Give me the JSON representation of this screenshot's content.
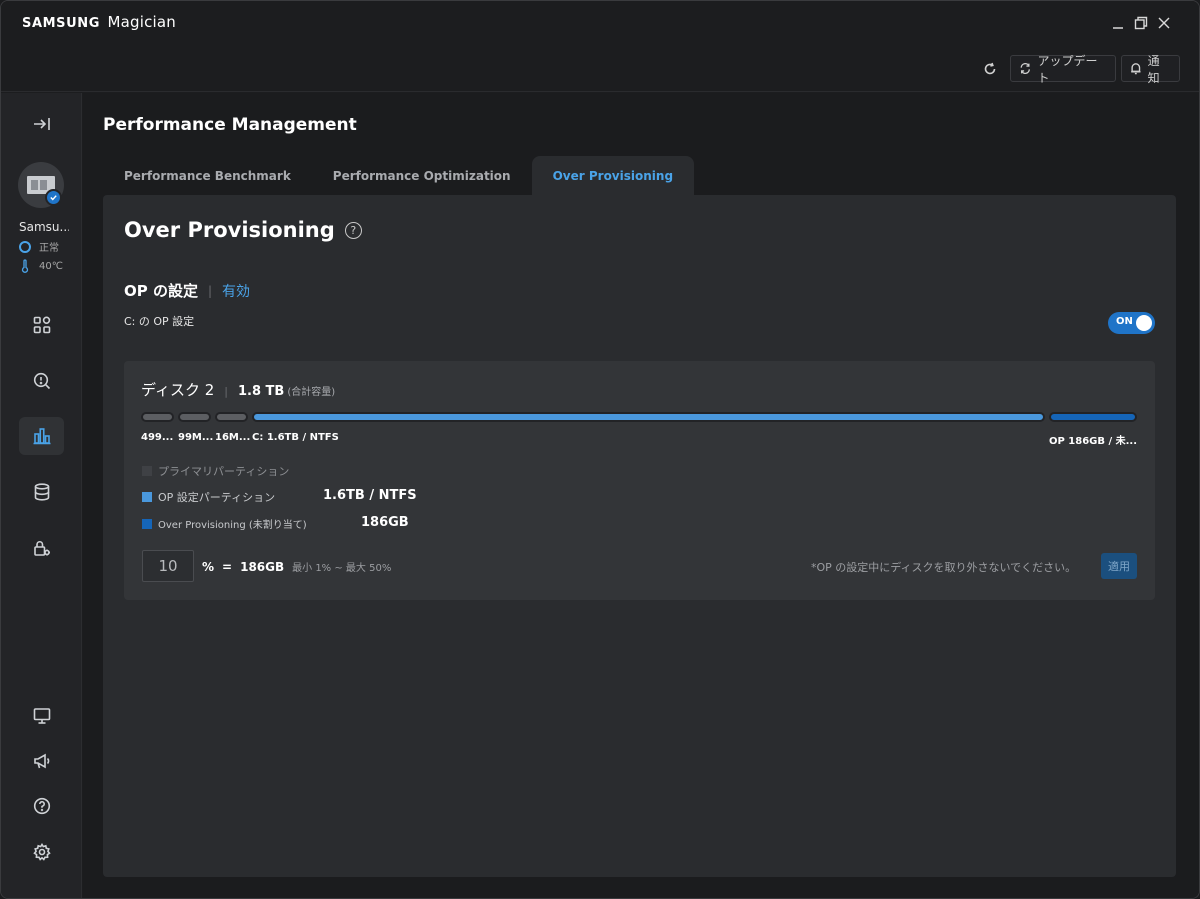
{
  "app": {
    "brand": "SAMSUNG",
    "product": "Magician"
  },
  "header": {
    "update_label": "アップデート",
    "notify_label": "通知"
  },
  "sidebar": {
    "device_name": "Samsu...",
    "device_status": "正常",
    "device_temp": "40℃"
  },
  "main": {
    "page_title": "Performance Management",
    "tabs": [
      {
        "label": "Performance Benchmark",
        "active": false
      },
      {
        "label": "Performance Optimization",
        "active": false
      },
      {
        "label": "Over Provisioning",
        "active": true
      }
    ]
  },
  "op": {
    "title": "Over Provisioning",
    "help": "?",
    "setting_label": "OP の設定",
    "setting_status": "有効",
    "drive_setting_label": "C: の OP 設定",
    "toggle_label": "ON",
    "toggle_on": true
  },
  "disk": {
    "name": "ディスク 2",
    "capacity": "1.8 TB",
    "capacity_sub": "(合計容量)",
    "segments": [
      {
        "label": "499...",
        "kind": "gray"
      },
      {
        "label": "99M...",
        "kind": "gray"
      },
      {
        "label": "16M...",
        "kind": "gray"
      },
      {
        "label": "C: 1.6TB / NTFS",
        "kind": "blue"
      },
      {
        "label": "OP 186GB / 未...",
        "kind": "darkblue"
      }
    ],
    "legend": [
      {
        "label": "プライマリパーティション",
        "value": "",
        "color": "#3f4145"
      },
      {
        "label": "OP 設定パーティション",
        "value": "1.6TB / NTFS",
        "color": "#4a98dd"
      },
      {
        "label": "Over Provisioning (未割り当て)",
        "value": "186GB",
        "color": "#1565b8"
      }
    ],
    "percent_value": "10",
    "percent_sign": "%",
    "equals": "=",
    "result": "186GB",
    "range": "最小 1% ~ 最大 50%",
    "warning": "*OP の設定中にディスクを取り外さないでください。",
    "apply_label": "適用"
  },
  "colors": {
    "accent": "#4aa3e8",
    "toggle": "#1f74c8"
  }
}
